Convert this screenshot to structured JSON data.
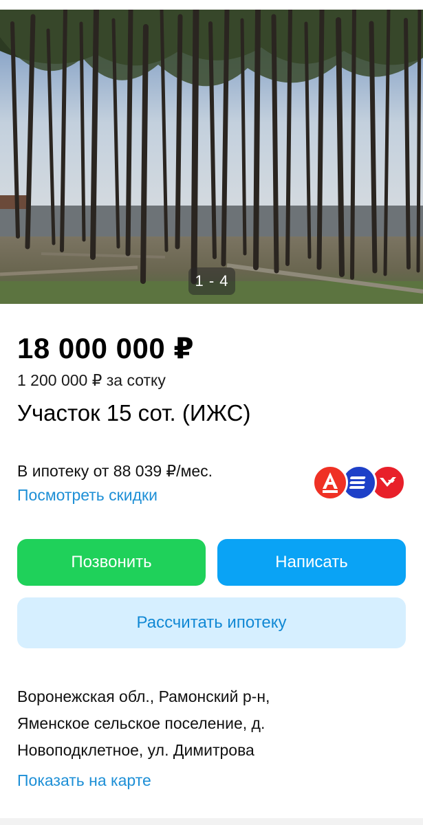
{
  "gallery": {
    "counter": "1 - 4"
  },
  "listing": {
    "price": "18 000 000 ₽",
    "price_per_unit": "1 200 000 ₽ за сотку",
    "title": "Участок 15 сот. (ИЖС)"
  },
  "mortgage": {
    "text": "В ипотеку от 88 039 ₽/мес.",
    "discounts_link": "Посмотреть скидки",
    "banks": [
      "alfa-bank-logo",
      "bank-logo-2",
      "bank-logo-3"
    ]
  },
  "actions": {
    "call_label": "Позвонить",
    "write_label": "Написать",
    "mortgage_calc_label": "Рассчитать ипотеку"
  },
  "address": {
    "lines": [
      "Воронежская обл., Рамонский р-н,",
      "Яменское сельское поселение, д.",
      "Новоподклетное, ул. Димитрова"
    ],
    "map_link": "Показать на карте"
  },
  "colors": {
    "call_button": "#1fd15a",
    "write_button": "#0aa3f5",
    "mortgage_button_bg": "#d6efff",
    "link": "#1d8fd6",
    "alfa_red": "#ef3124",
    "bank2_blue": "#1e40c8",
    "bank3_red": "#e8202a"
  }
}
